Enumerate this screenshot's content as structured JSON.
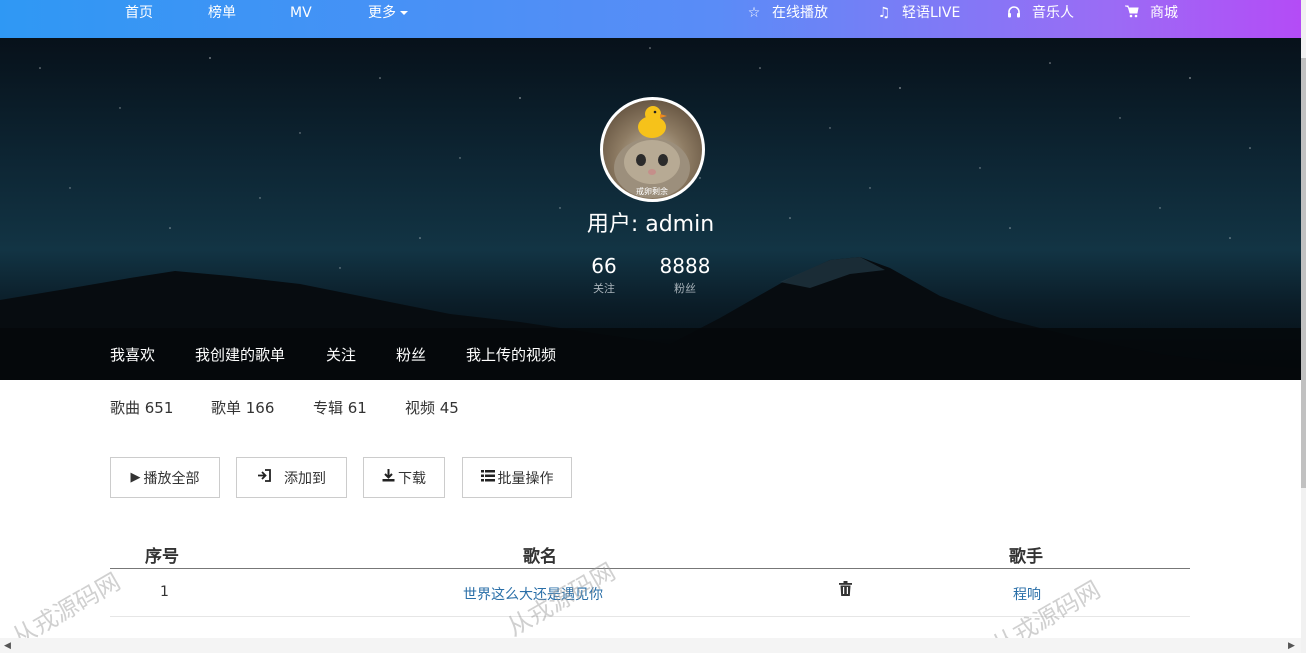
{
  "nav": {
    "left": [
      "首页",
      "榜单",
      "MV",
      "更多"
    ],
    "right": [
      {
        "icon": "star-icon",
        "label": "在线播放"
      },
      {
        "icon": "music-note-icon",
        "label": "轻语LIVE"
      },
      {
        "icon": "headphones-icon",
        "label": "音乐人"
      },
      {
        "icon": "cart-icon",
        "label": "商城"
      }
    ]
  },
  "profile": {
    "username": "用户: admin",
    "avatar_text": "戒卵剩余",
    "follow_count": "66",
    "follow_label": "关注",
    "fans_count": "8888",
    "fans_label": "粉丝"
  },
  "tabs": [
    "我喜欢",
    "我创建的歌单",
    "关注",
    "粉丝",
    "我上传的视频"
  ],
  "counts": [
    "歌曲 651",
    "歌单 166",
    "专辑 61",
    "视频 45"
  ],
  "actions": {
    "play_all": "播放全部",
    "add_to": "添加到",
    "download": "下载",
    "batch": "批量操作"
  },
  "table": {
    "headers": [
      "序号",
      "歌名",
      "歌手"
    ],
    "rows": [
      {
        "index": "1",
        "title": "世界这么大还是遇见你",
        "artist": "程响"
      }
    ]
  },
  "watermark": "从戎源码网",
  "colors": {
    "nav_gradient_start": "#2f98f4",
    "nav_gradient_end": "#b44cf6",
    "link": "#2a6fa8"
  }
}
